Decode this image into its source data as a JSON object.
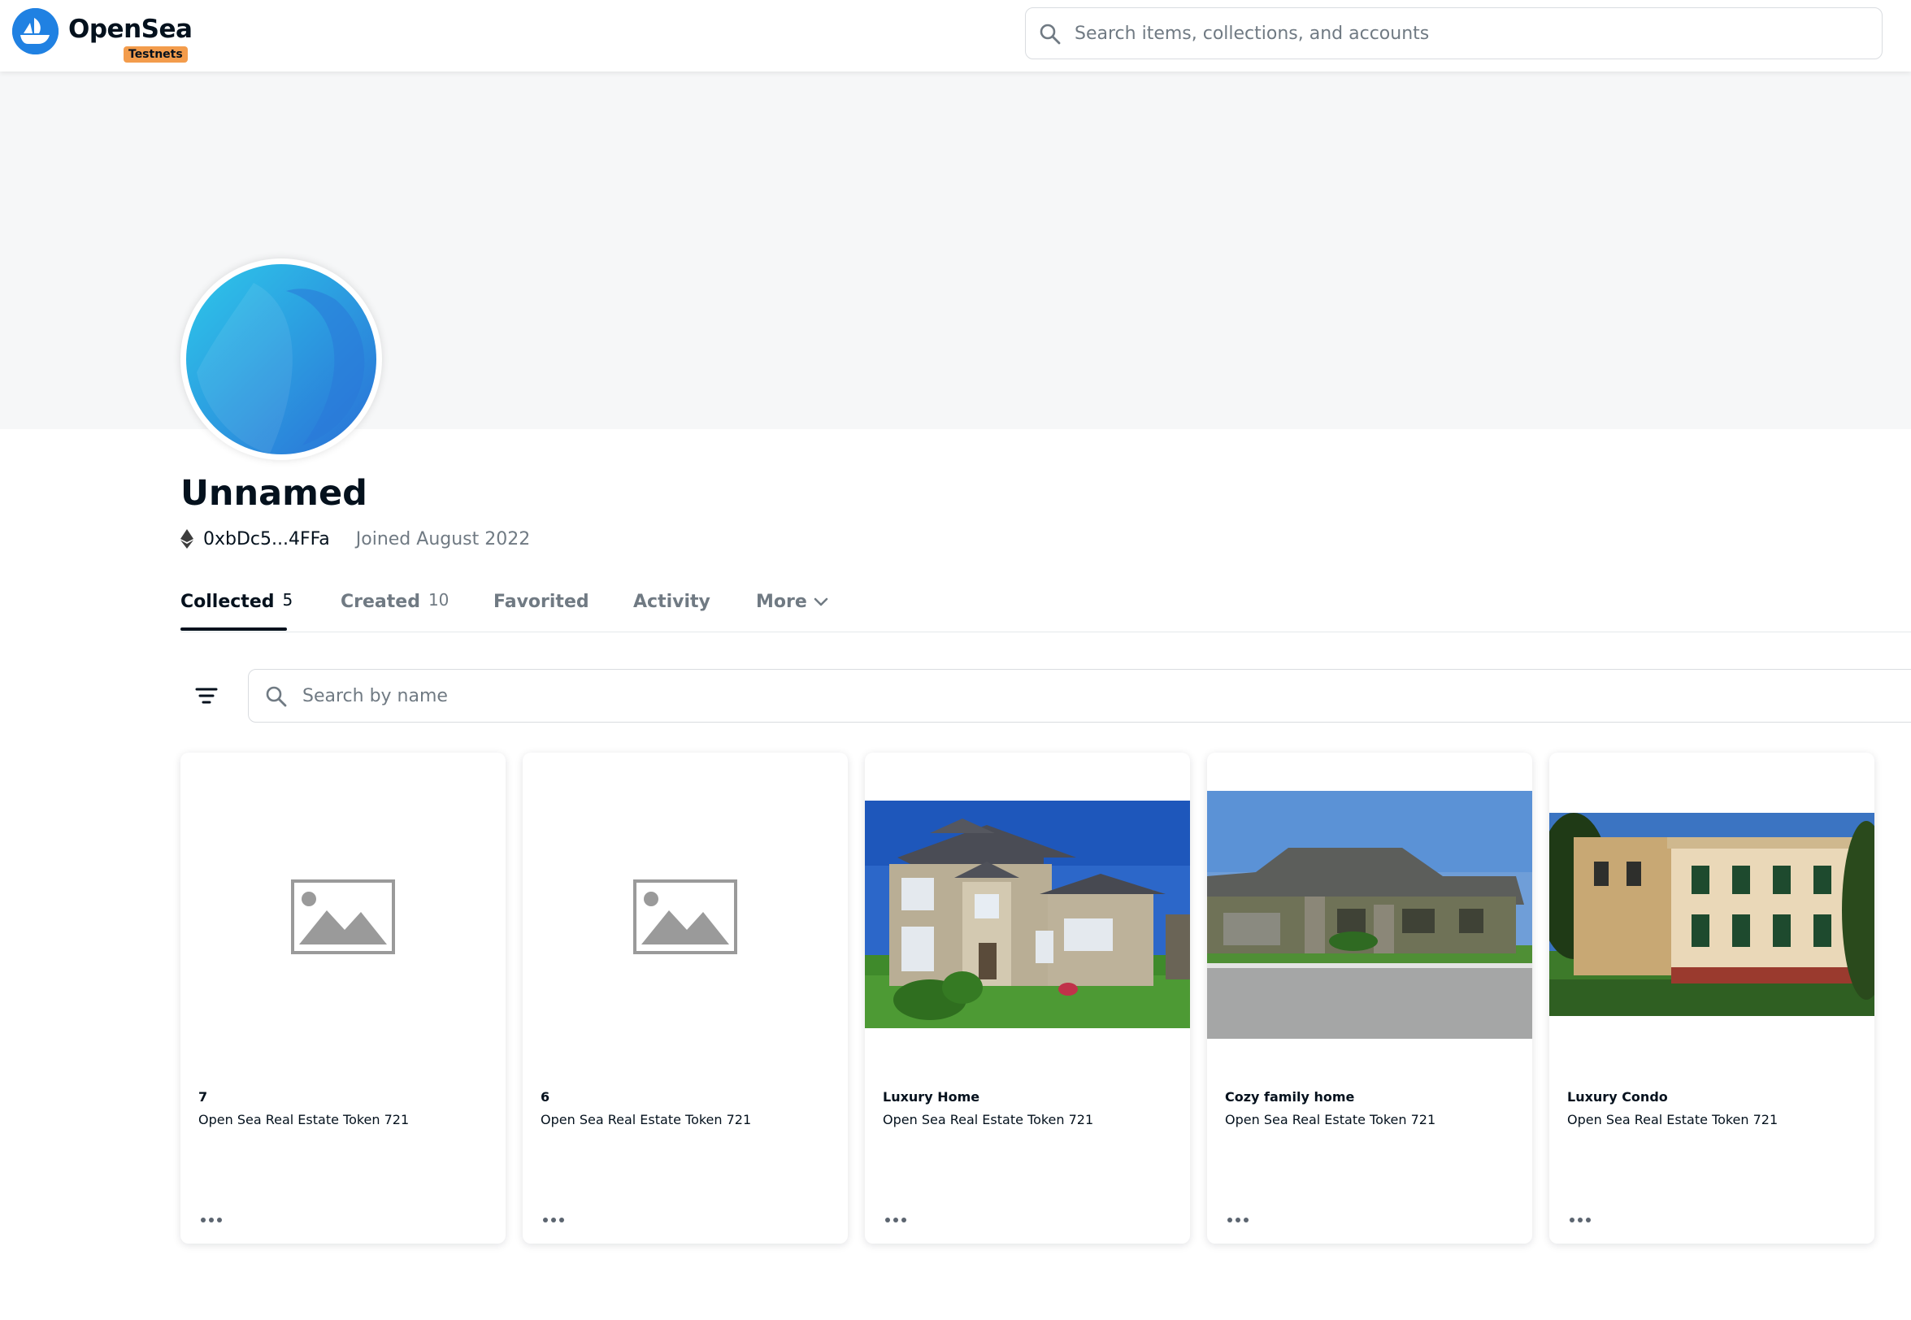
{
  "header": {
    "brand": "OpenSea",
    "badge": "Testnets",
    "logo_icon": "opensea-boat-logo-icon",
    "search_placeholder": "Search items, collections, and accounts"
  },
  "profile": {
    "name": "Unnamed",
    "address": "0xbDc5...4FFa",
    "joined": "Joined August 2022",
    "chain_icon": "ethereum-icon"
  },
  "tabs": [
    {
      "label": "Collected",
      "count": "5",
      "active": true
    },
    {
      "label": "Created",
      "count": "10"
    },
    {
      "label": "Favorited"
    },
    {
      "label": "Activity"
    },
    {
      "label": "More",
      "icon": "chevron-down-icon"
    }
  ],
  "items_search": {
    "placeholder": "Search by name",
    "filter_icon": "filter-icon"
  },
  "cards": [
    {
      "title": "7",
      "collection": "Open Sea Real Estate Token 721",
      "media": "image-placeholder-icon"
    },
    {
      "title": "6",
      "collection": "Open Sea Real Estate Token 721",
      "media": "image-placeholder-icon"
    },
    {
      "title": "Luxury Home",
      "collection": "Open Sea Real Estate Token 721",
      "media": "house-photo"
    },
    {
      "title": "Cozy family home",
      "collection": "Open Sea Real Estate Token 721",
      "media": "ranch-house-photo"
    },
    {
      "title": "Luxury Condo",
      "collection": "Open Sea Real Estate Token 721",
      "media": "historic-building-photo"
    }
  ],
  "colors": {
    "brand_blue": "#2081e2",
    "badge_orange": "#f39c4c",
    "text_primary": "#04111d",
    "text_secondary": "#707a83",
    "banner_bg": "#f6f7f8"
  }
}
